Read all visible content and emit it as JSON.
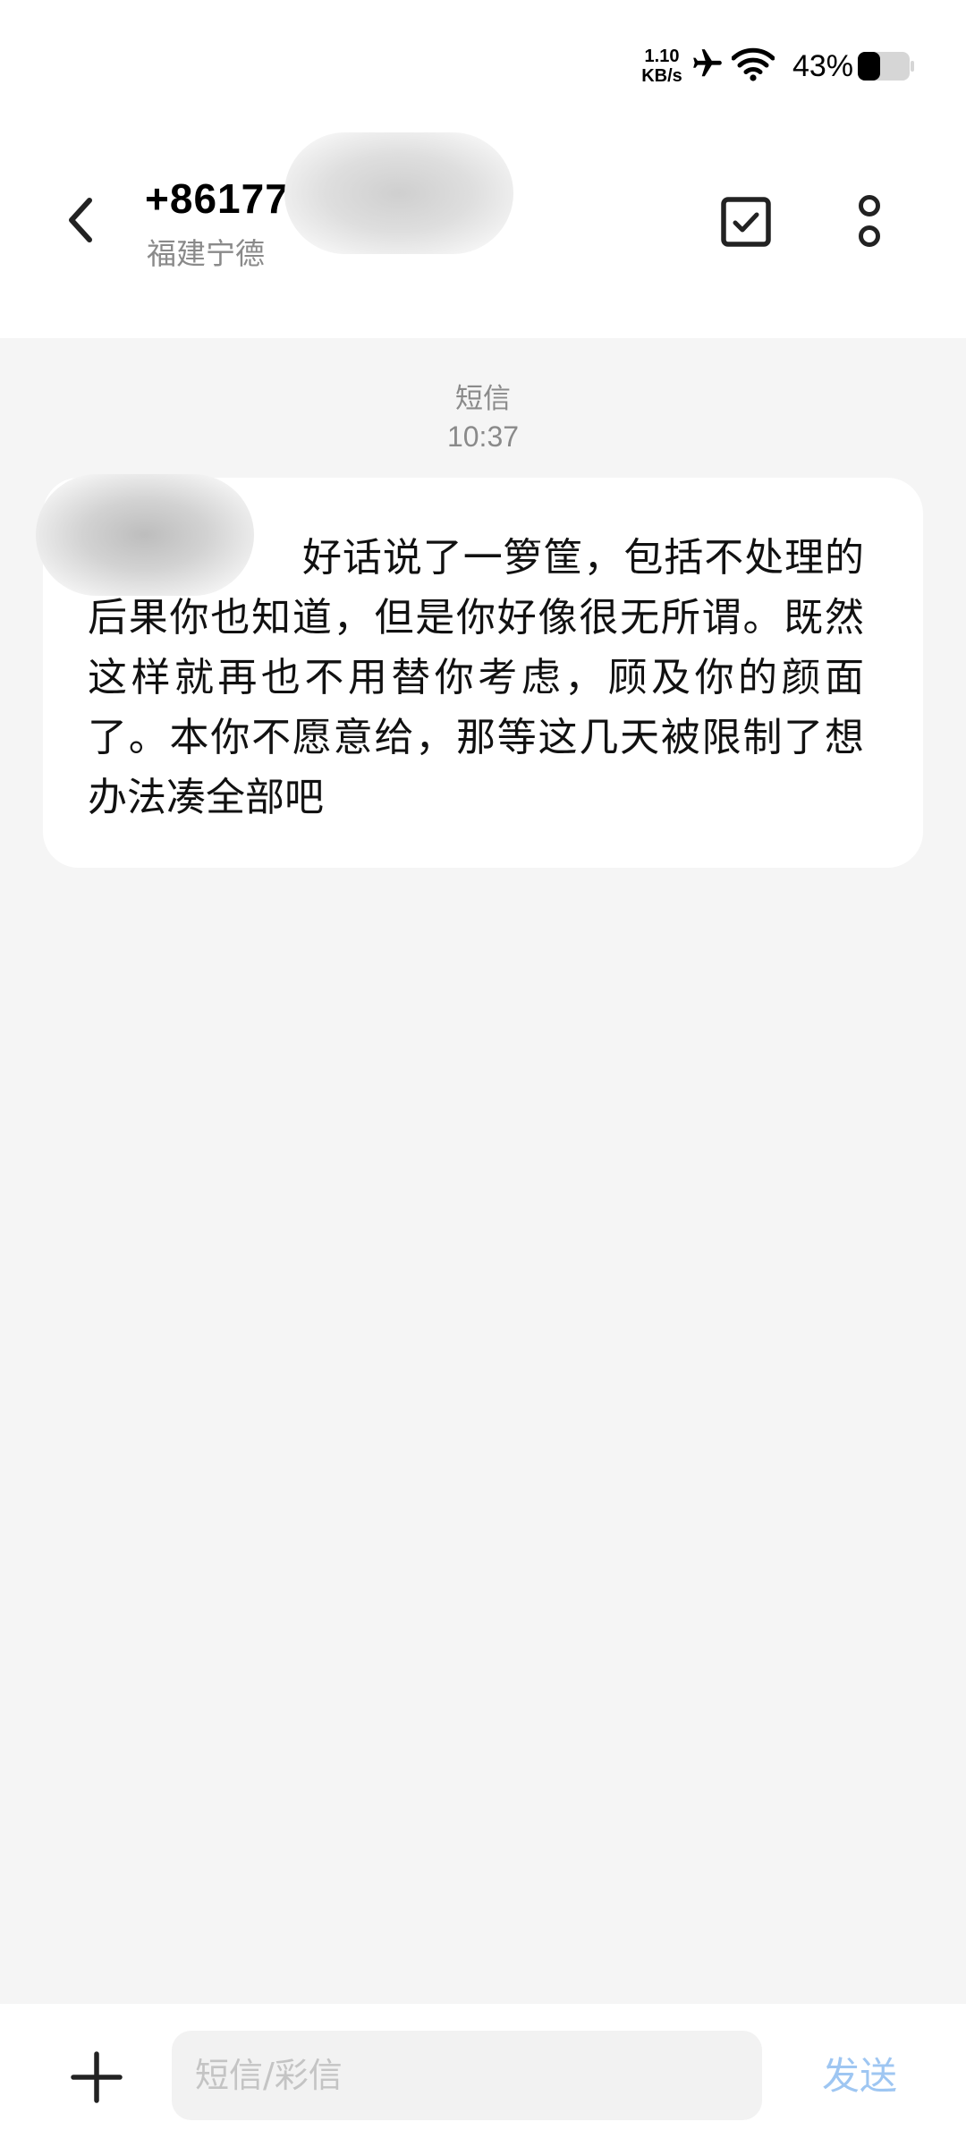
{
  "status_bar": {
    "net_speed_value": "1.10",
    "net_speed_unit": "KB/s",
    "battery_percent": "43%",
    "battery_level": 0.43,
    "icons": [
      "airplane-icon",
      "wifi-icon",
      "battery-icon"
    ]
  },
  "header": {
    "contact_number": "+86177",
    "contact_location": "福建宁德",
    "icons": [
      "chevron-left-icon",
      "checkbox-icon",
      "more-vertical-icon"
    ]
  },
  "conversation": {
    "message_type": "短信",
    "message_time": "10:37",
    "message_text": "好话说了一箩筐，包括不处理的后果你也知道，但是你好像很无所谓。既然这样就再也不用替你考虑，顾及你的颜面了。本你不愿意给，那等这几天被限制了想办法凑全部吧"
  },
  "input_bar": {
    "placeholder": "短信/彩信",
    "value": "",
    "send_label": "发送",
    "icons": [
      "plus-icon"
    ]
  },
  "colors": {
    "background": "#f5f5f5",
    "bubble": "#ffffff",
    "secondary_text": "#8a8a8a",
    "send_disabled": "#9ec6f2"
  }
}
